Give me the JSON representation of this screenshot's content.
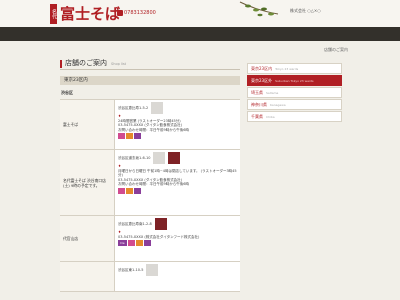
{
  "header": {
    "logo_mark": "名代",
    "logo_name": "富士そば",
    "phone": "0783132800",
    "company": "株式会社 ○△×○"
  },
  "breadcrumb": "店舗のご案内",
  "main": {
    "title": "店舗のご案内",
    "title_en": "Shop list",
    "section": "東京23区内",
    "area": "渋谷区",
    "stores": [
      {
        "name": "富士そば",
        "address": "渋谷区恵比寿1-5-2",
        "hours": "24時間営業 (ラストオーダー23時45分)",
        "tel": "03-5475-XXXX (ダイタン飲食株式会社)",
        "notes": "お問い合わせ時間：平日午前9時から午後6時",
        "has_second_photo": false
      },
      {
        "name": "名代富士そば 渋谷南口店 (土) 9時の予定です。",
        "address": "渋谷区道玄坂1-6-10",
        "hours": "月曜日から日曜日 午前1時~4時は閉店しています。 (ラストオーダー3時45分)",
        "tel": "03-5475-XXXX (ダイタン飲食株式会社)",
        "notes": "お問い合わせ時間：平日午前9時から午後6時",
        "has_second_photo": true
      },
      {
        "name": "代官山店",
        "address": "渋谷区恵比寿南1-2-8",
        "hours": "",
        "tel": "03-5475-XXXX (株式会社ダイタンフード株式会社)",
        "notes": "",
        "has_second_photo": false
      },
      {
        "name": "",
        "address": "渋谷区東1-10-5",
        "hours": "",
        "tel": "",
        "notes": "",
        "has_second_photo": false
      }
    ]
  },
  "sidebar": {
    "items": [
      {
        "label": "東京23区内",
        "en": "Tokyo 23 wards",
        "active": false
      },
      {
        "label": "東京23区外",
        "en": "Suburban Tokyo 23 wards",
        "active": true
      },
      {
        "label": "埼玉県",
        "en": "Saitama",
        "active": false
      },
      {
        "label": "神奈川県",
        "en": "Kanagawa",
        "active": false
      },
      {
        "label": "千葉県",
        "en": "Chiba",
        "active": false
      }
    ]
  },
  "colors": {
    "brand_red": "#b01f24",
    "dark_band": "#33302b",
    "page_bg": "#f1efe8"
  },
  "icons": [
    "phone-icon",
    "map-pin-icon",
    "service-icon-pink",
    "service-icon-orange",
    "service-icon-purple"
  ]
}
